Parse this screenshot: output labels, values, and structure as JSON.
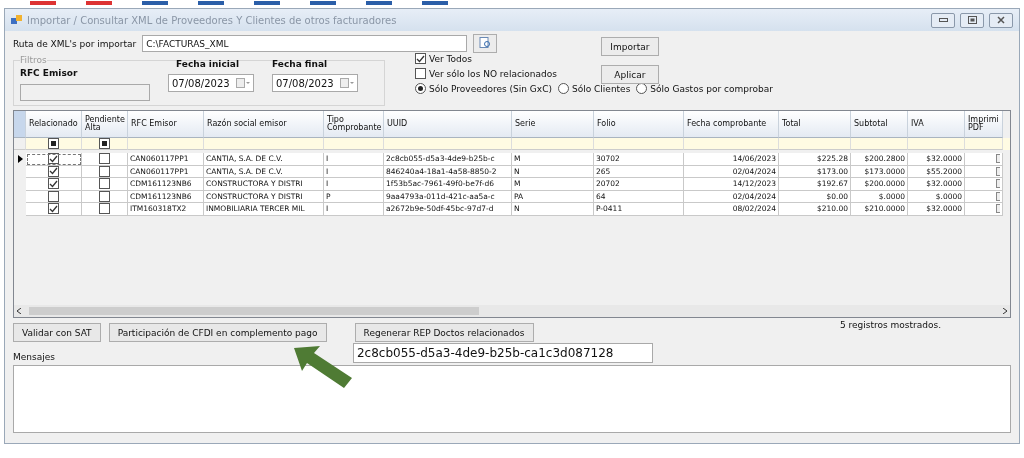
{
  "window": {
    "title": "Importar / Consultar XML de Proveedores Y Clientes de otros facturadores"
  },
  "path": {
    "label": "Ruta de XML's por importar",
    "value": "C:\\FACTURAS_XML"
  },
  "buttons_top": [
    "Importar",
    "Aplicar"
  ],
  "filters": {
    "title": "Filtros",
    "rfc_label": "RFC Emisor",
    "fecha_inicial": {
      "label": "Fecha inicial",
      "value": "07/08/2023"
    },
    "fecha_final": {
      "label": "Fecha final",
      "value": "07/08/2023"
    }
  },
  "checkboxes": [
    {
      "label": "Ver Todos",
      "checked": true
    },
    {
      "label": "Ver sólo los NO relacionados",
      "checked": false
    }
  ],
  "radios": [
    {
      "label": "Sólo Proveedores (Sin GxC)",
      "selected": true
    },
    {
      "label": "Sólo Clientes",
      "selected": false
    },
    {
      "label": "Sólo Gastos por comprobar",
      "selected": false
    }
  ],
  "table": {
    "columns": [
      {
        "label": "Relacionado",
        "kind": "check",
        "filter_indeterminate": true
      },
      {
        "label": "Pendiente Alta",
        "kind": "check",
        "filter_indeterminate": true
      },
      {
        "label": "RFC Emisor",
        "kind": "text"
      },
      {
        "label": "Razón social emisor",
        "kind": "text"
      },
      {
        "label": "Tipo Comprobante",
        "kind": "text"
      },
      {
        "label": "UUID",
        "kind": "text"
      },
      {
        "label": "Serie",
        "kind": "text"
      },
      {
        "label": "Folio",
        "kind": "text"
      },
      {
        "label": "Fecha comprobante",
        "kind": "number"
      },
      {
        "label": "Total",
        "kind": "number"
      },
      {
        "label": "Subtotal",
        "kind": "number"
      },
      {
        "label": "IVA",
        "kind": "number"
      },
      {
        "label": "Imprimi PDF",
        "kind": "pdf"
      }
    ],
    "rows": [
      {
        "current": true,
        "cells": [
          true,
          false,
          "CAN060117PP1",
          "CANTIA, S.A. DE C.V.",
          "I",
          "2c8cb055-d5a3-4de9-b25b-c",
          "M",
          "30702",
          "14/06/2023",
          "$225.28",
          "$200.2800",
          "$32.0000",
          ""
        ]
      },
      {
        "current": false,
        "cells": [
          true,
          false,
          "CAN060117PP1",
          "CANTIA, S.A. DE C.V.",
          "I",
          "846240a4-18a1-4a58-8850-2",
          "N",
          "265",
          "02/04/2024",
          "$173.00",
          "$173.0000",
          "$55.2000",
          ""
        ]
      },
      {
        "current": false,
        "cells": [
          true,
          false,
          "CDM161123NB6",
          "CONSTRUCTORA Y DISTRI",
          "I",
          "1f53b5ac-7961-49f0-be7f-d6",
          "M",
          "20702",
          "14/12/2023",
          "$192.67",
          "$200.0000",
          "$32.0000",
          ""
        ]
      },
      {
        "current": false,
        "cells": [
          false,
          false,
          "CDM161123NB6",
          "CONSTRUCTORA Y DISTRI",
          "P",
          "9aa4793a-011d-421c-aa5a-c",
          "PA",
          "64",
          "02/04/2024",
          "$0.00",
          "$.0000",
          "$.0000",
          ""
        ]
      },
      {
        "current": false,
        "cells": [
          true,
          false,
          "ITM160318TX2",
          "INMOBILIARIA TERCER MIL",
          "I",
          "a2672b9e-50df-45bc-97d7-d",
          "N",
          "P-0411",
          "08/02/2024",
          "$210.00",
          "$210.0000",
          "$32.0000",
          ""
        ]
      }
    ]
  },
  "buttons_bottom": [
    "Validar con SAT",
    "Participación de CFDI en complemento pago",
    "Regenerar  REP Doctos relacionados"
  ],
  "record_count": "5 registros mostrados.",
  "uuid_field": {
    "value": "2c8cb055-d5a3-4de9-b25b-ca1c3d087128"
  },
  "messages": {
    "label": "Mensajes"
  }
}
